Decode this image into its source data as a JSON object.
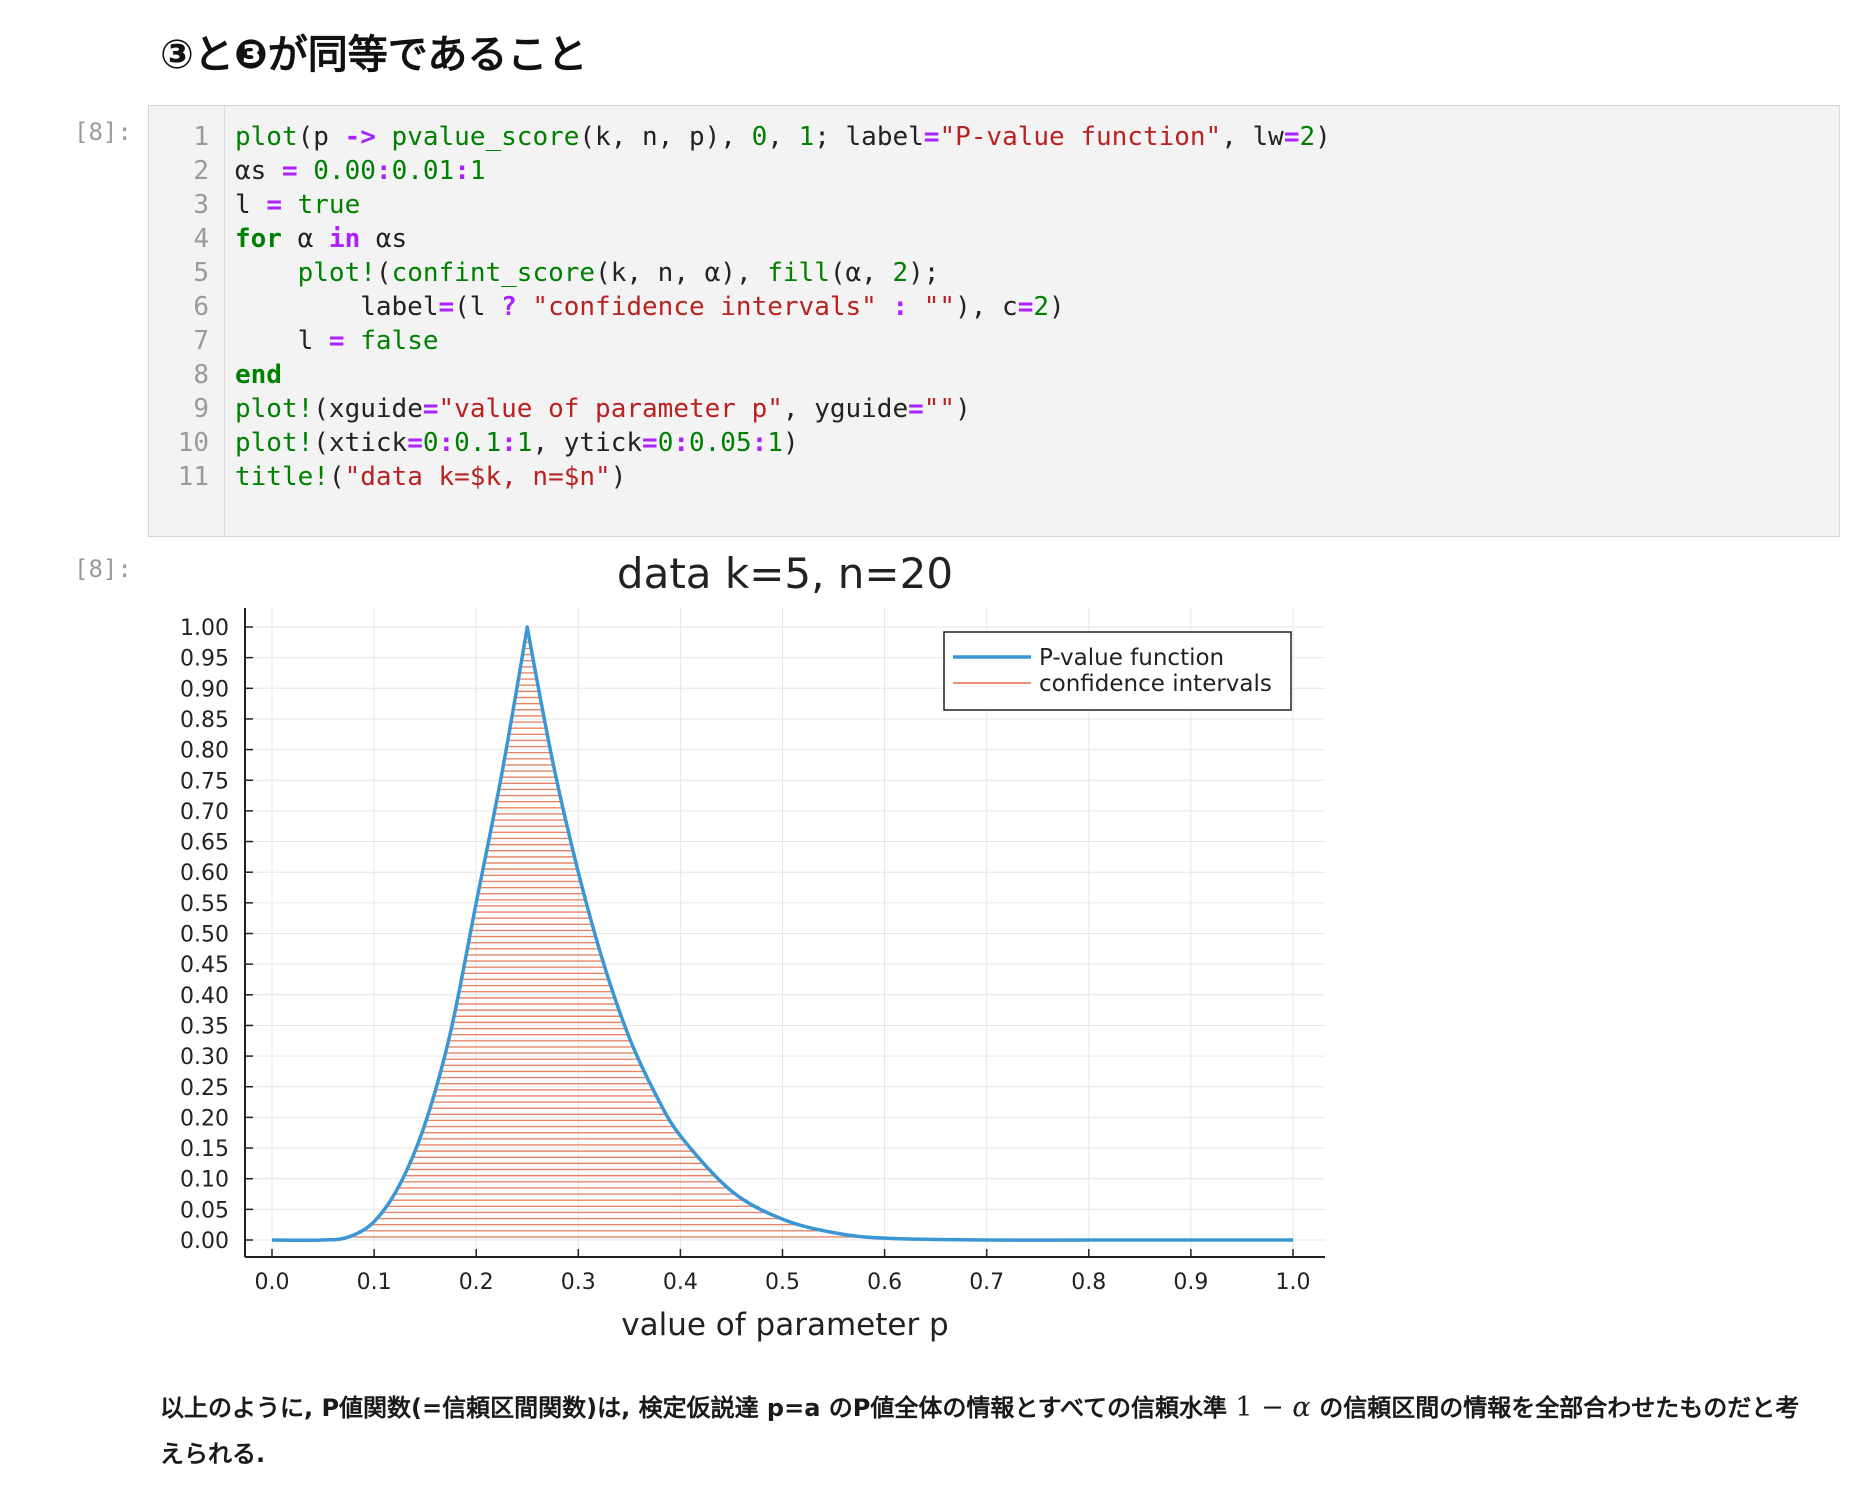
{
  "heading": "③と❸が同等であること",
  "input_prompt": "[8]:",
  "output_prompt": "[8]:",
  "code_lines": [
    {
      "num": "1",
      "tokens": [
        [
          "f",
          "plot"
        ],
        [
          "",
          "(p "
        ],
        [
          "o",
          "->"
        ],
        [
          "f",
          " pvalue_score"
        ],
        [
          "",
          "(k, n, p), "
        ],
        [
          "n",
          "0"
        ],
        [
          "",
          ", "
        ],
        [
          "n",
          "1"
        ],
        [
          "",
          "; label"
        ],
        [
          "o",
          "="
        ],
        [
          "s",
          "\"P-value function\""
        ],
        [
          "",
          ", lw"
        ],
        [
          "o",
          "="
        ],
        [
          "n",
          "2"
        ],
        [
          "",
          ")"
        ]
      ]
    },
    {
      "num": "2",
      "tokens": [
        [
          "",
          "αs "
        ],
        [
          "o",
          "="
        ],
        [
          "n",
          " 0.00"
        ],
        [
          "o",
          ":"
        ],
        [
          "n",
          "0.01"
        ],
        [
          "o",
          ":"
        ],
        [
          "n",
          "1"
        ]
      ]
    },
    {
      "num": "3",
      "tokens": [
        [
          "",
          "l "
        ],
        [
          "o",
          "="
        ],
        [
          "n",
          " true"
        ]
      ]
    },
    {
      "num": "4",
      "tokens": [
        [
          "k",
          "for"
        ],
        [
          "",
          " α "
        ],
        [
          "o",
          "in"
        ],
        [
          "",
          " αs"
        ]
      ]
    },
    {
      "num": "5",
      "tokens": [
        [
          "",
          "    "
        ],
        [
          "f",
          "plot!"
        ],
        [
          "",
          "("
        ],
        [
          "f",
          "confint_score"
        ],
        [
          "",
          "(k, n, α), "
        ],
        [
          "f",
          "fill"
        ],
        [
          "",
          "(α, "
        ],
        [
          "n",
          "2"
        ],
        [
          "",
          ");"
        ]
      ]
    },
    {
      "num": "6",
      "tokens": [
        [
          "",
          "        label"
        ],
        [
          "o",
          "="
        ],
        [
          "",
          "(l "
        ],
        [
          "o",
          "?"
        ],
        [
          "s",
          " \"confidence intervals\""
        ],
        [
          "o",
          " :"
        ],
        [
          "s",
          " \"\""
        ],
        [
          "",
          "), c"
        ],
        [
          "o",
          "="
        ],
        [
          "n",
          "2"
        ],
        [
          "",
          ")"
        ]
      ]
    },
    {
      "num": "7",
      "tokens": [
        [
          "",
          "    l "
        ],
        [
          "o",
          "="
        ],
        [
          "n",
          " false"
        ]
      ]
    },
    {
      "num": "8",
      "tokens": [
        [
          "k",
          "end"
        ]
      ]
    },
    {
      "num": "9",
      "tokens": [
        [
          "f",
          "plot!"
        ],
        [
          "",
          "(xguide"
        ],
        [
          "o",
          "="
        ],
        [
          "s",
          "\"value of parameter p\""
        ],
        [
          "",
          ", yguide"
        ],
        [
          "o",
          "="
        ],
        [
          "s",
          "\"\""
        ],
        [
          "",
          ")"
        ]
      ]
    },
    {
      "num": "10",
      "tokens": [
        [
          "f",
          "plot!"
        ],
        [
          "",
          "(xtick"
        ],
        [
          "o",
          "="
        ],
        [
          "n",
          "0"
        ],
        [
          "o",
          ":"
        ],
        [
          "n",
          "0.1"
        ],
        [
          "o",
          ":"
        ],
        [
          "n",
          "1"
        ],
        [
          "",
          ", ytick"
        ],
        [
          "o",
          "="
        ],
        [
          "n",
          "0"
        ],
        [
          "o",
          ":"
        ],
        [
          "n",
          "0.05"
        ],
        [
          "o",
          ":"
        ],
        [
          "n",
          "1"
        ],
        [
          "",
          ")"
        ]
      ]
    },
    {
      "num": "11",
      "tokens": [
        [
          "f",
          "title!"
        ],
        [
          "",
          "("
        ],
        [
          "s",
          "\"data k=$k, n=$n\""
        ],
        [
          "",
          ")"
        ]
      ]
    }
  ],
  "chart_data": {
    "type": "line",
    "title": "data k=5, n=20",
    "xlabel": "value of parameter p",
    "ylabel": "",
    "xlim": [
      0,
      1
    ],
    "ylim": [
      0,
      1
    ],
    "x_ticks": [
      "0.0",
      "0.1",
      "0.2",
      "0.3",
      "0.4",
      "0.5",
      "0.6",
      "0.7",
      "0.8",
      "0.9",
      "1.0"
    ],
    "y_ticks": [
      "0.00",
      "0.05",
      "0.10",
      "0.15",
      "0.20",
      "0.25",
      "0.30",
      "0.35",
      "0.40",
      "0.45",
      "0.50",
      "0.55",
      "0.60",
      "0.65",
      "0.70",
      "0.75",
      "0.80",
      "0.85",
      "0.90",
      "0.95",
      "1.00"
    ],
    "grid": true,
    "legend_position": "top-right",
    "legend": [
      "P-value function",
      "confidence intervals"
    ],
    "series": [
      {
        "name": "P-value function",
        "color": "#3a97d4",
        "x": [
          0.0,
          0.05,
          0.075,
          0.1,
          0.125,
          0.15,
          0.175,
          0.2,
          0.225,
          0.25,
          0.275,
          0.3,
          0.325,
          0.35,
          0.375,
          0.4,
          0.45,
          0.5,
          0.55,
          0.6,
          0.7,
          0.8,
          0.9,
          1.0
        ],
        "y": [
          0.0,
          0.0,
          0.005,
          0.03,
          0.09,
          0.19,
          0.34,
          0.55,
          0.76,
          1.0,
          0.78,
          0.6,
          0.45,
          0.33,
          0.24,
          0.17,
          0.08,
          0.034,
          0.012,
          0.003,
          0.0,
          0.0,
          0.0,
          0.0
        ]
      },
      {
        "name": "confidence intervals",
        "color": "#e2714d",
        "type": "hlines",
        "alpha_step": 0.01
      }
    ]
  },
  "paragraph": {
    "text_before": "以上のように, P値関数(=信頼区間関数)は, 検定仮説達 p=a のP値全体の情報とすべての信頼水準",
    "math_one": "1",
    "math_minus": "−",
    "math_alpha": "α",
    "text_after": "の信頼区間の情報を全部合わせたものだと考えられる."
  }
}
